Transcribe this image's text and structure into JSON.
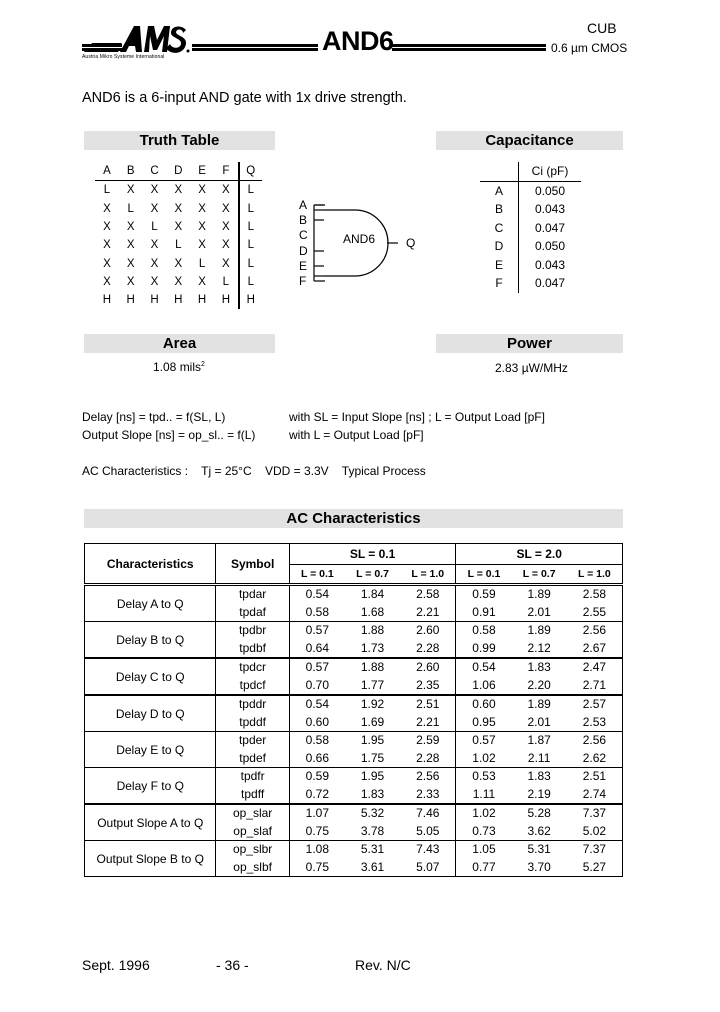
{
  "header": {
    "logo_text": "AMS",
    "logo_subtitle": "Austria Mikro Systeme International",
    "cell_name": "AND6",
    "library": "CUB",
    "technology": "0.6 µm CMOS"
  },
  "description": "AND6 is a 6-input AND gate with 1x drive strength.",
  "truth_table": {
    "title": "Truth Table",
    "columns": [
      "A",
      "B",
      "C",
      "D",
      "E",
      "F",
      "Q"
    ],
    "rows": [
      [
        "L",
        "X",
        "X",
        "X",
        "X",
        "X",
        "L"
      ],
      [
        "X",
        "L",
        "X",
        "X",
        "X",
        "X",
        "L"
      ],
      [
        "X",
        "X",
        "L",
        "X",
        "X",
        "X",
        "L"
      ],
      [
        "X",
        "X",
        "X",
        "L",
        "X",
        "X",
        "L"
      ],
      [
        "X",
        "X",
        "X",
        "X",
        "L",
        "X",
        "L"
      ],
      [
        "X",
        "X",
        "X",
        "X",
        "X",
        "L",
        "L"
      ],
      [
        "H",
        "H",
        "H",
        "H",
        "H",
        "H",
        "H"
      ]
    ]
  },
  "gate_symbol": {
    "label": "AND6",
    "inputs": [
      "A",
      "B",
      "C",
      "D",
      "E",
      "F"
    ],
    "output": "Q"
  },
  "capacitance": {
    "title": "Capacitance",
    "column_header": "Ci (pF)",
    "rows": [
      {
        "pin": "A",
        "value": "0.050"
      },
      {
        "pin": "B",
        "value": "0.043"
      },
      {
        "pin": "C",
        "value": "0.047"
      },
      {
        "pin": "D",
        "value": "0.050"
      },
      {
        "pin": "E",
        "value": "0.043"
      },
      {
        "pin": "F",
        "value": "0.047"
      }
    ]
  },
  "area": {
    "title": "Area",
    "value": "1.08  mils",
    "unit_sup": "2"
  },
  "power": {
    "title": "Power",
    "value": "2.83 µW/MHz"
  },
  "formulas": {
    "delay_left": "Delay [ns]  =  tpd..  =  f(SL, L)",
    "delay_right": "with  SL = Input Slope [ns] ;  L = Output Load [pF]",
    "slope_left": "Output Slope [ns]  =  op_sl..  =  f(L)",
    "slope_right": "with  L = Output Load [pF]"
  },
  "conditions": "AC Characteristics :    Tj = 25°C    VDD = 3.3V    Typical Process",
  "ac_table": {
    "title": "AC Characteristics",
    "col_characteristics": "Characteristics",
    "col_symbol": "Symbol",
    "sl_groups": [
      "SL = 0.1",
      "SL = 2.0"
    ],
    "loads": [
      "L = 0.1",
      "L = 0.7",
      "L = 1.0",
      "L = 0.1",
      "L = 0.7",
      "L = 1.0"
    ],
    "rows": [
      {
        "name": "Delay A to Q",
        "symbols": [
          "tpdar",
          "tpdaf"
        ],
        "values": [
          [
            "0.54",
            "1.84",
            "2.58",
            "0.59",
            "1.89",
            "2.58"
          ],
          [
            "0.58",
            "1.68",
            "2.21",
            "0.91",
            "2.01",
            "2.55"
          ]
        ]
      },
      {
        "name": "Delay B to Q",
        "symbols": [
          "tpdbr",
          "tpdbf"
        ],
        "values": [
          [
            "0.57",
            "1.88",
            "2.60",
            "0.58",
            "1.89",
            "2.56"
          ],
          [
            "0.64",
            "1.73",
            "2.28",
            "0.99",
            "2.12",
            "2.67"
          ]
        ]
      },
      {
        "name": "Delay C to Q",
        "symbols": [
          "tpdcr",
          "tpdcf"
        ],
        "values": [
          [
            "0.57",
            "1.88",
            "2.60",
            "0.54",
            "1.83",
            "2.47"
          ],
          [
            "0.70",
            "1.77",
            "2.35",
            "1.06",
            "2.20",
            "2.71"
          ]
        ]
      },
      {
        "name": "Delay D to Q",
        "symbols": [
          "tpddr",
          "tpddf"
        ],
        "values": [
          [
            "0.54",
            "1.92",
            "2.51",
            "0.60",
            "1.89",
            "2.57"
          ],
          [
            "0.60",
            "1.69",
            "2.21",
            "0.95",
            "2.01",
            "2.53"
          ]
        ]
      },
      {
        "name": "Delay E to Q",
        "symbols": [
          "tpder",
          "tpdef"
        ],
        "values": [
          [
            "0.58",
            "1.95",
            "2.59",
            "0.57",
            "1.87",
            "2.56"
          ],
          [
            "0.66",
            "1.75",
            "2.28",
            "1.02",
            "2.11",
            "2.62"
          ]
        ]
      },
      {
        "name": "Delay F to Q",
        "symbols": [
          "tpdfr",
          "tpdff"
        ],
        "values": [
          [
            "0.59",
            "1.95",
            "2.56",
            "0.53",
            "1.83",
            "2.51"
          ],
          [
            "0.72",
            "1.83",
            "2.33",
            "1.11",
            "2.19",
            "2.74"
          ]
        ]
      },
      {
        "name": "Output Slope A to Q",
        "symbols": [
          "op_slar",
          "op_slaf"
        ],
        "values": [
          [
            "1.07",
            "5.32",
            "7.46",
            "1.02",
            "5.28",
            "7.37"
          ],
          [
            "0.75",
            "3.78",
            "5.05",
            "0.73",
            "3.62",
            "5.02"
          ]
        ]
      },
      {
        "name": "Output Slope B to Q",
        "symbols": [
          "op_slbr",
          "op_slbf"
        ],
        "values": [
          [
            "1.08",
            "5.31",
            "7.43",
            "1.05",
            "5.31",
            "7.37"
          ],
          [
            "0.75",
            "3.61",
            "5.07",
            "0.77",
            "3.70",
            "5.27"
          ]
        ]
      }
    ]
  },
  "footer": {
    "date": "Sept. 1996",
    "page": "- 36 -",
    "revision": "Rev. N/C"
  }
}
